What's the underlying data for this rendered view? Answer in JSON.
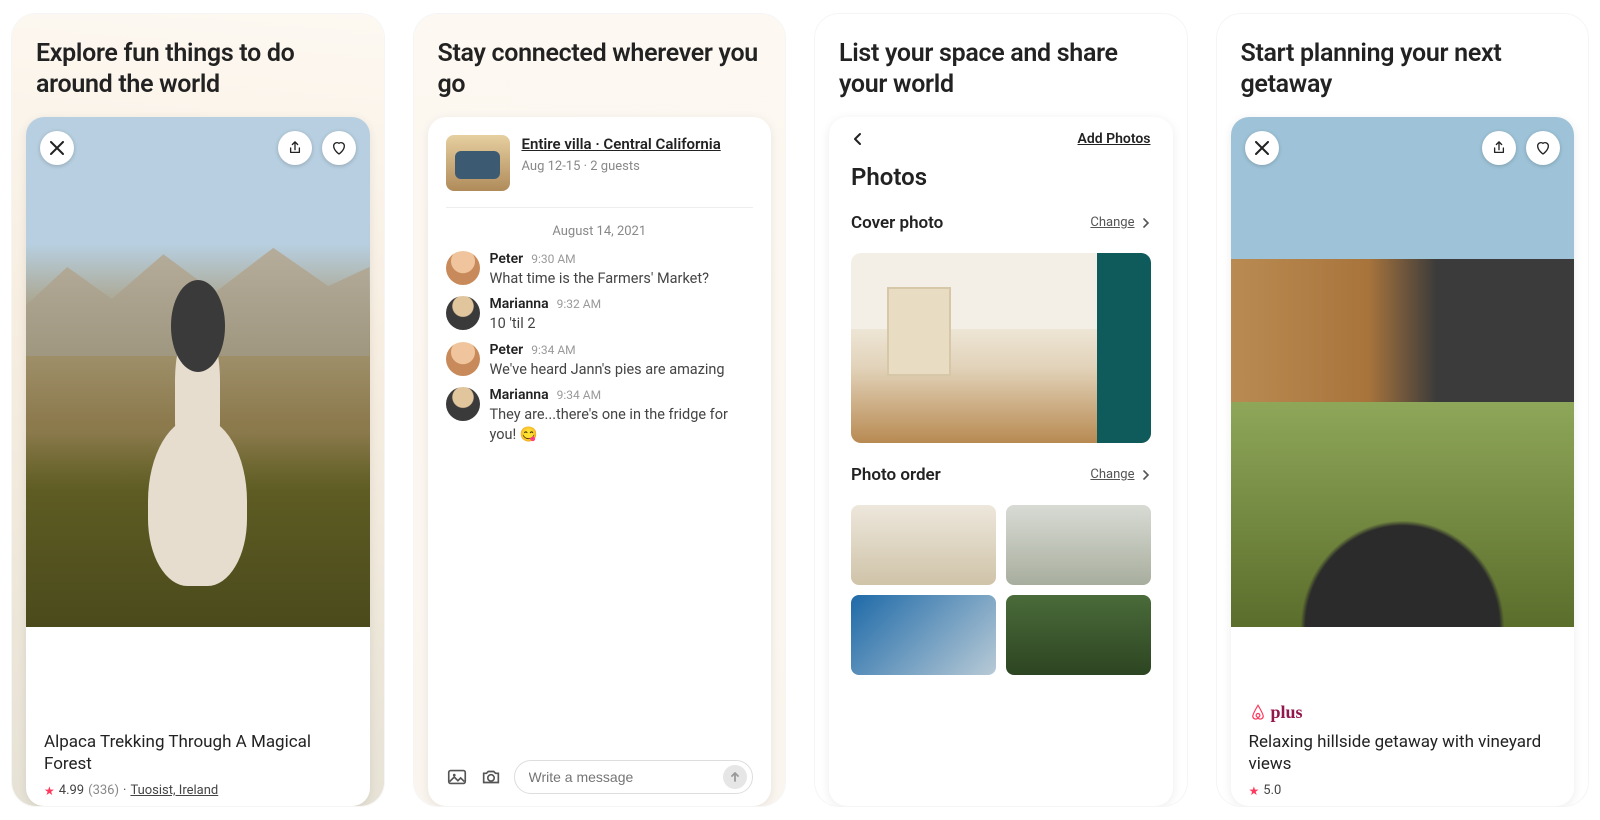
{
  "panels": {
    "explore": {
      "title": "Explore fun things to do around the world",
      "listing_title": "Alpaca Trekking Through A Magical Forest",
      "rating": "4.99",
      "reviews": "(336)",
      "location": "Tuosist, Ireland"
    },
    "connected": {
      "title": "Stay connected wherever you go",
      "booking": {
        "name": "Entire villa · Central California",
        "dates": "Aug 12-15 · 2 guests"
      },
      "date_divider": "August 14, 2021",
      "messages": [
        {
          "name": "Peter",
          "time": "9:30 AM",
          "text": "What time is the Farmers' Market?",
          "avatar": "peter"
        },
        {
          "name": "Marianna",
          "time": "9:32 AM",
          "text": "10 'til 2",
          "avatar": "marianna"
        },
        {
          "name": "Peter",
          "time": "9:34 AM",
          "text": "We've heard Jann's pies are amazing",
          "avatar": "peter"
        },
        {
          "name": "Marianna",
          "time": "9:34 AM",
          "text": "They are...there's one in the fridge for you! 😋",
          "avatar": "marianna"
        }
      ],
      "composer_placeholder": "Write a message"
    },
    "list_space": {
      "title": "List your space and share your world",
      "add_photos": "Add Photos",
      "heading": "Photos",
      "cover_section": "Cover photo",
      "order_section": "Photo order",
      "change": "Change"
    },
    "getaway": {
      "title": "Start planning your next getaway",
      "brand": "plus",
      "listing_title": "Relaxing hillside getaway with vineyard views",
      "rating": "5.0"
    }
  }
}
